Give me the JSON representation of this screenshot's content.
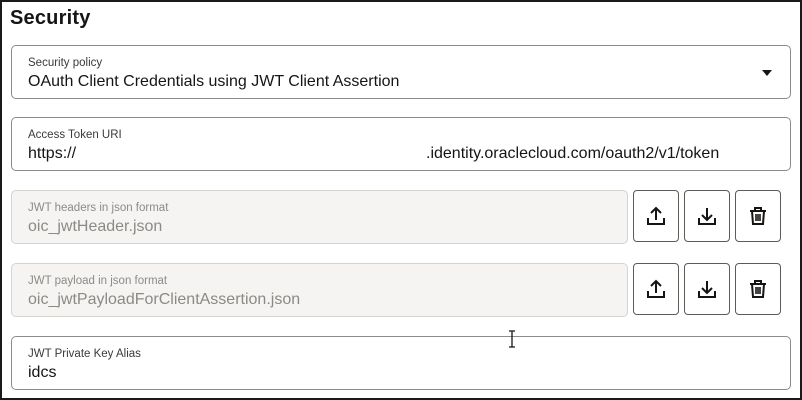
{
  "section": {
    "title": "Security"
  },
  "security_policy": {
    "label": "Security policy",
    "value": "OAuth Client Credentials using JWT Client Assertion",
    "icon": "chevron-down-icon"
  },
  "access_token_uri": {
    "label": "Access Token URI",
    "value_prefix": "https://",
    "value_suffix": ".identity.oraclecloud.com/oauth2/v1/token"
  },
  "jwt_headers": {
    "label": "JWT headers in json format",
    "value": "oic_jwtHeader.json",
    "disabled": true,
    "actions": [
      "upload-icon",
      "download-icon",
      "trash-icon"
    ]
  },
  "jwt_payload": {
    "label": "JWT payload in json format",
    "value": "oic_jwtPayloadForClientAssertion.json",
    "disabled": true,
    "actions": [
      "upload-icon",
      "download-icon",
      "trash-icon"
    ]
  },
  "jwt_private_key_alias": {
    "label": "JWT Private Key Alias",
    "value": "idcs"
  },
  "colors": {
    "text": "#161513",
    "border": "#8e8c89",
    "disabled_background": "#f5f4f2",
    "disabled_text": "#8d8a86"
  }
}
